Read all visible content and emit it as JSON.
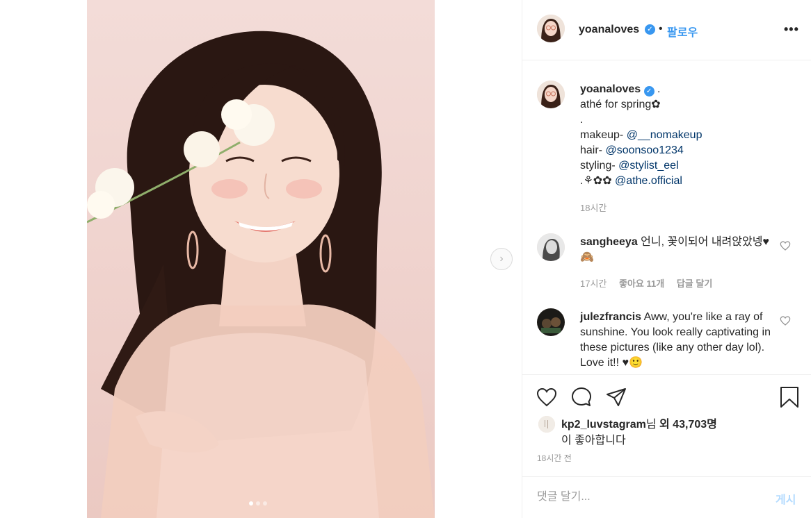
{
  "header": {
    "username": "yoanaloves",
    "separator": "•",
    "follow_label": "팔로우",
    "more_label": "•••"
  },
  "media": {
    "next_arrow": "›",
    "slide_count": 3,
    "active_slide": 1
  },
  "caption": {
    "username": "yoanaloves",
    "first": " .",
    "lines": [
      "athé for spring✿",
      "."
    ],
    "credits": [
      {
        "label": "makeup- ",
        "mention": "@__nomakeup"
      },
      {
        "label": "hair- ",
        "mention": "@soonsoo1234"
      },
      {
        "label": "styling- ",
        "mention": "@stylist_eel"
      },
      {
        "label": ".⚘✿✿ ",
        "mention": "@athe.official"
      }
    ],
    "time": "18시간"
  },
  "comments": [
    {
      "username": "sangheeya",
      "text": " 언니, 꽃이되어 내려앉았넹♥🙈",
      "time": "17시간",
      "likes": "좋아요 11개",
      "reply": "답글 달기"
    },
    {
      "username": "julezfrancis",
      "text": " Aww, you're like a ray of sunshine. You look really captivating in these pictures (like any other day lol). Love it!! ♥🙂"
    }
  ],
  "likes": {
    "liker": "kp2_luvstagram",
    "suffix1": "님 ",
    "others": "외 43,703명",
    "line2": "이 좋아합니다"
  },
  "timestamp": "18시간 전",
  "add_comment": {
    "placeholder": "댓글 달기...",
    "post_label": "게시"
  },
  "icons": {
    "like": "heart-icon",
    "comment": "comment-icon",
    "share": "share-icon",
    "save": "bookmark-icon",
    "verified": "verified-badge-icon"
  },
  "colors": {
    "accent": "#3897f0",
    "mention": "#003569",
    "muted": "#999999",
    "post_disabled": "#b3dbff"
  }
}
